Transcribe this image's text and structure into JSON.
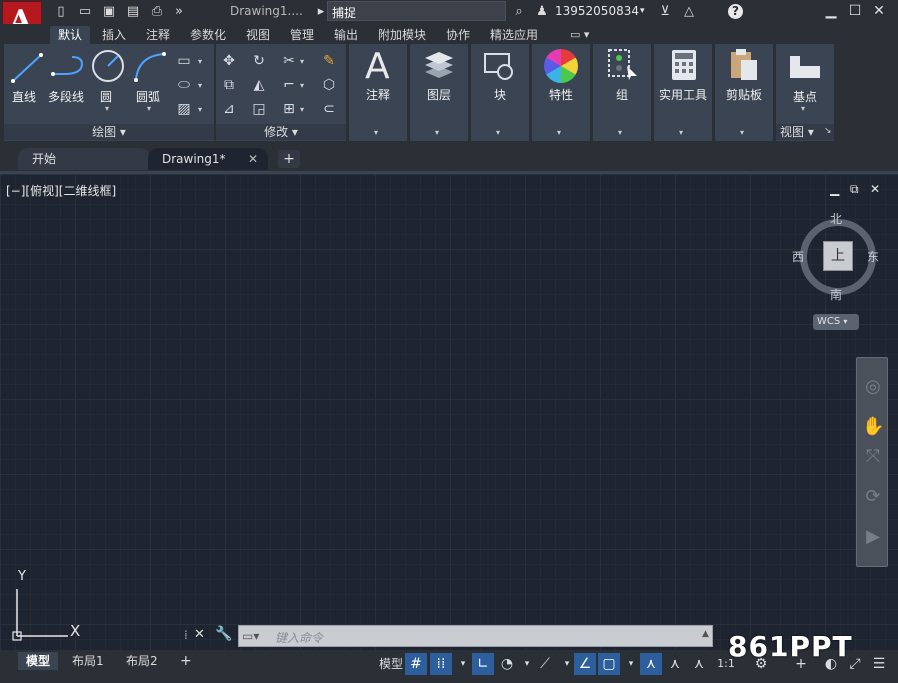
{
  "title_bar": {
    "app_letter": "A",
    "doc_title": "Drawing1....",
    "search_value": "捕捉",
    "user": "13952050834",
    "help": "?"
  },
  "ribbon_tabs": [
    "默认",
    "插入",
    "注释",
    "参数化",
    "视图",
    "管理",
    "输出",
    "附加模块",
    "协作",
    "精选应用"
  ],
  "ribbon": {
    "draw_panel": {
      "title": "绘图 ▾",
      "tools": [
        "直线",
        "多段线",
        "圆",
        "圆弧"
      ]
    },
    "modify_panel": {
      "title": "修改 ▾"
    },
    "big_tools": [
      "注释",
      "图层",
      "块",
      "特性",
      "组",
      "实用工具",
      "剪贴板"
    ],
    "view_panel": {
      "tool": "基点",
      "title": "视图 ▾"
    }
  },
  "file_tabs": {
    "start": "开始",
    "drawing": "Drawing1*",
    "close": "✕",
    "add": "+"
  },
  "viewport": {
    "label": "[−][俯视][二维线框]",
    "compass": {
      "north": "北",
      "south": "南",
      "east": "东",
      "west": "西"
    },
    "cube_face": "上",
    "wcs": "WCS"
  },
  "ucs": {
    "y": "Y",
    "x": "X"
  },
  "command_line": {
    "placeholder": "键入命令"
  },
  "layout_tabs": [
    "模型",
    "布局1",
    "布局2"
  ],
  "status": {
    "model": "模型",
    "scale": "1:1"
  },
  "watermark": "861PPT"
}
